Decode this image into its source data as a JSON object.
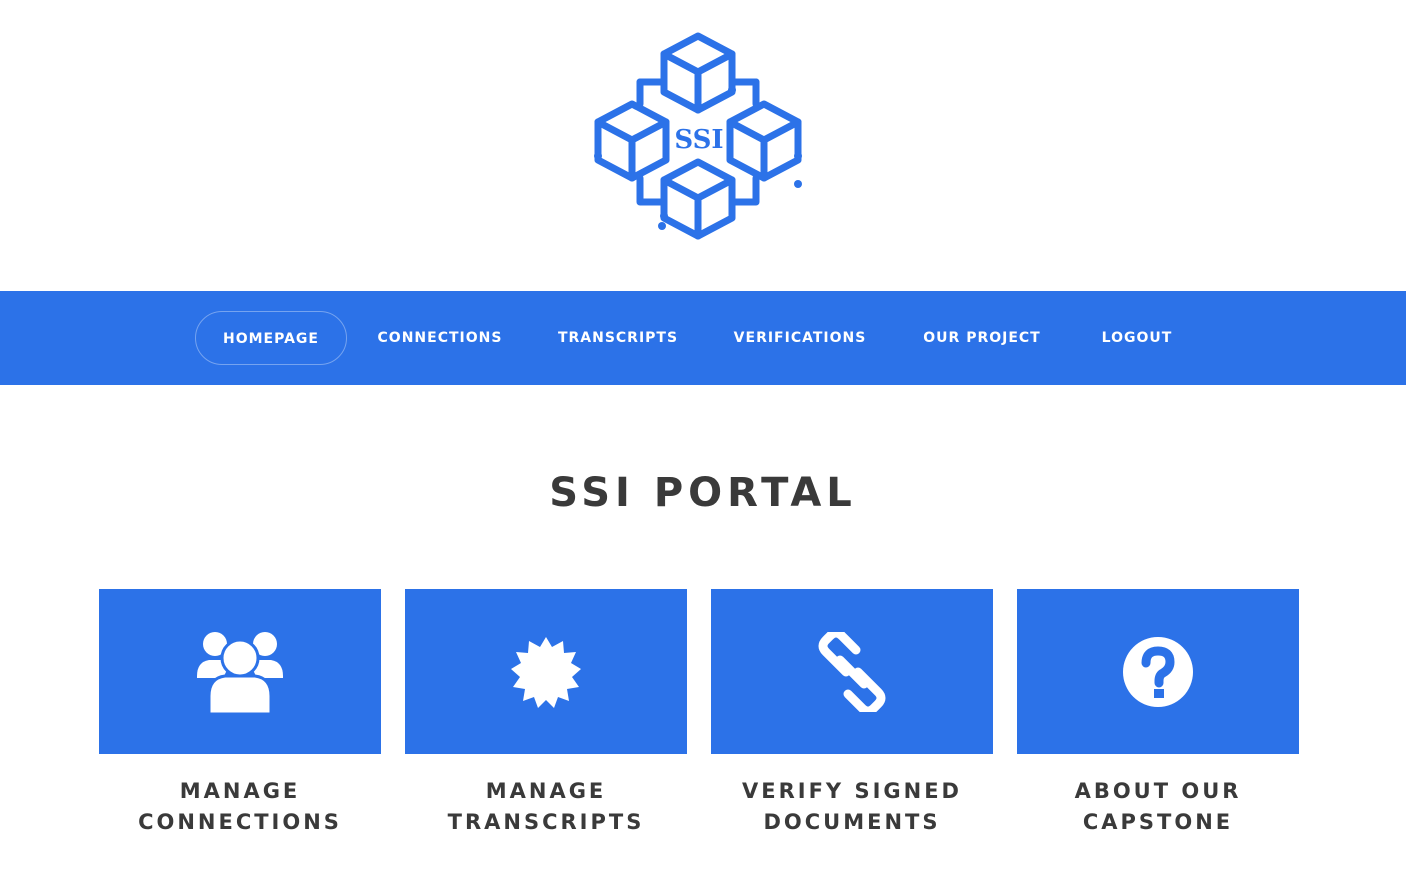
{
  "logo": {
    "text": "SSI",
    "color": "#2c72e8"
  },
  "nav": {
    "items": [
      {
        "label": "HOMEPAGE",
        "active": true
      },
      {
        "label": "CONNECTIONS",
        "active": false
      },
      {
        "label": "TRANSCRIPTS",
        "active": false
      },
      {
        "label": "VERIFICATIONS",
        "active": false
      },
      {
        "label": "OUR PROJECT",
        "active": false
      },
      {
        "label": "LOGOUT",
        "active": false
      }
    ],
    "background": "#2c72e8"
  },
  "main": {
    "title": "SSI PORTAL",
    "cards": [
      {
        "icon": "users-icon",
        "line1": "MANAGE",
        "line2": "CONNECTIONS"
      },
      {
        "icon": "badge-icon",
        "line1": "MANAGE",
        "line2": "TRANSCRIPTS"
      },
      {
        "icon": "link-icon",
        "line1": "VERIFY SIGNED",
        "line2": "DOCUMENTS"
      },
      {
        "icon": "question-circle-icon",
        "line1": "ABOUT OUR",
        "line2": "CAPSTONE"
      }
    ]
  },
  "colors": {
    "accent": "#2c72e8",
    "text": "#3a3a3a",
    "background": "#ffffff"
  }
}
